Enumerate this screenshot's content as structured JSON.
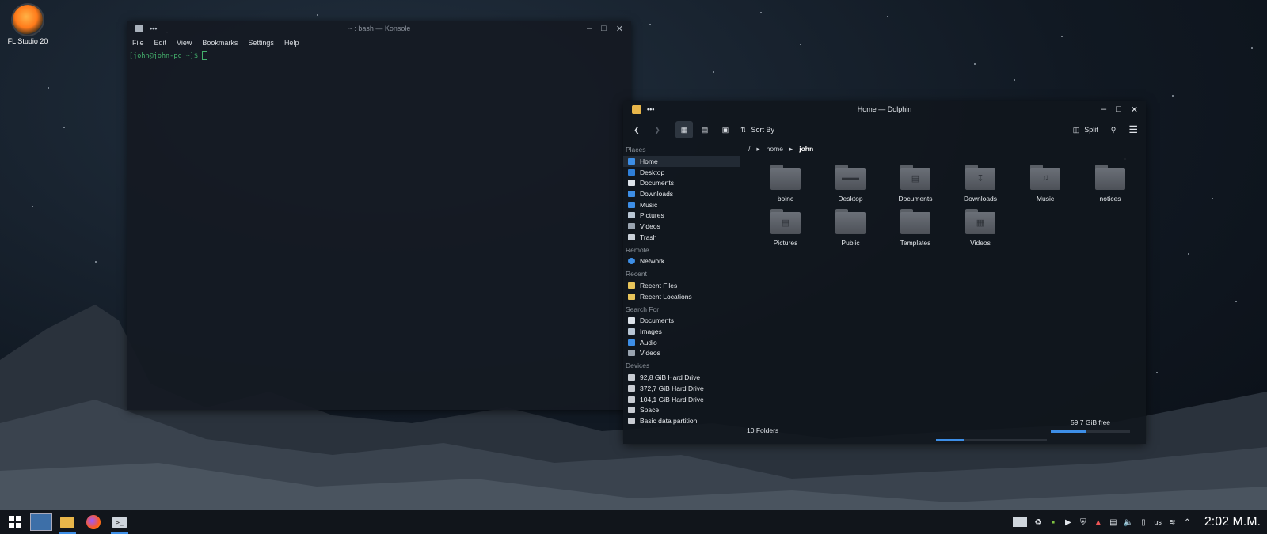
{
  "desktop": {
    "icon_label": "FL Studio 20"
  },
  "konsole": {
    "title": "~ : bash — Konsole",
    "menu": [
      "File",
      "Edit",
      "View",
      "Bookmarks",
      "Settings",
      "Help"
    ],
    "prompt": "[john@john-pc ~]$"
  },
  "dolphin": {
    "title": "Home — Dolphin",
    "toolbar": {
      "sort_by": "Sort By",
      "split": "Split"
    },
    "sidebar": {
      "places_header": "Places",
      "places": [
        "Home",
        "Desktop",
        "Documents",
        "Downloads",
        "Music",
        "Pictures",
        "Videos",
        "Trash"
      ],
      "remote_header": "Remote",
      "remote": [
        "Network"
      ],
      "recent_header": "Recent",
      "recent": [
        "Recent Files",
        "Recent Locations"
      ],
      "search_header": "Search For",
      "search": [
        "Documents",
        "Images",
        "Audio",
        "Videos"
      ],
      "devices_header": "Devices",
      "devices": [
        "92,8 GiB Hard Drive",
        "372,7 GiB Hard Drive",
        "104,1 GiB Hard Drive",
        "Space",
        "Basic data partition"
      ]
    },
    "breadcrumb": {
      "root": "/",
      "home": "home",
      "current": "john"
    },
    "folders": [
      "boinc",
      "Desktop",
      "Documents",
      "Downloads",
      "Music",
      "notices",
      "Pictures",
      "Public",
      "Templates",
      "Videos"
    ],
    "status": {
      "count": "10 Folders",
      "free": "59,7 GiB free",
      "free_bar_fraction": 0.45,
      "progress_fraction": 0.25
    }
  },
  "taskbar": {
    "keyboard_layout": "us",
    "clock": "2:02 M.M."
  },
  "colors": {
    "accent": "#3d8ee6",
    "prompt_green": "#44b06c"
  }
}
